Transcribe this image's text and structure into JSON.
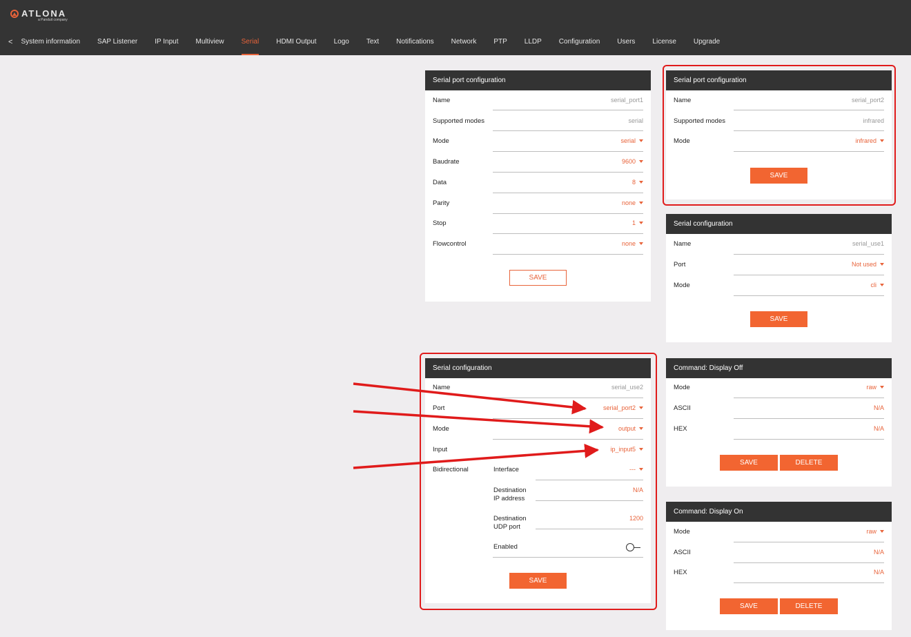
{
  "header": {
    "logo_text": "ATLONA",
    "logo_sub": "a Panduit company",
    "back_label": "<",
    "tabs": [
      "System information",
      "SAP Listener",
      "IP Input",
      "Multiview",
      "Serial",
      "HDMI Output",
      "Logo",
      "Text",
      "Notifications",
      "Network",
      "PTP",
      "LLDP",
      "Configuration",
      "Users",
      "License",
      "Upgrade"
    ],
    "active_tab": "Serial"
  },
  "port1": {
    "title": "Serial port configuration",
    "name_label": "Name",
    "name_value": "serial_port1",
    "modes_label": "Supported modes",
    "modes_value": "serial",
    "mode_label": "Mode",
    "mode_value": "serial",
    "baud_label": "Baudrate",
    "baud_value": "9600",
    "data_label": "Data",
    "data_value": "8",
    "parity_label": "Parity",
    "parity_value": "none",
    "stop_label": "Stop",
    "stop_value": "1",
    "flow_label": "Flowcontrol",
    "flow_value": "none",
    "save_label": "SAVE"
  },
  "port2": {
    "title": "Serial port configuration",
    "name_label": "Name",
    "name_value": "serial_port2",
    "modes_label": "Supported modes",
    "modes_value": "infrared",
    "mode_label": "Mode",
    "mode_value": "infrared",
    "save_label": "SAVE"
  },
  "use1": {
    "title": "Serial configuration",
    "name_label": "Name",
    "name_value": "serial_use1",
    "port_label": "Port",
    "port_value": "Not used",
    "mode_label": "Mode",
    "mode_value": "cli",
    "save_label": "SAVE"
  },
  "use2": {
    "title": "Serial configuration",
    "name_label": "Name",
    "name_value": "serial_use2",
    "port_label": "Port",
    "port_value": "serial_port2",
    "mode_label": "Mode",
    "mode_value": "output",
    "input_label": "Input",
    "input_value": "ip_input5",
    "bidir_label": "Bidirectional",
    "iface_label": "Interface",
    "iface_value": "---",
    "dest_ip_label_1": "Destination",
    "dest_ip_label_2": "IP address",
    "dest_ip_value": "N/A",
    "dest_udp_label_1": "Destination",
    "dest_udp_label_2": "UDP port",
    "dest_udp_value": "1200",
    "enabled_label": "Enabled",
    "save_label": "SAVE"
  },
  "cmd_off": {
    "title": "Command: Display Off",
    "mode_label": "Mode",
    "mode_value": "raw",
    "ascii_label": "ASCII",
    "ascii_value": "N/A",
    "hex_label": "HEX",
    "hex_value": "N/A",
    "save_label": "SAVE",
    "delete_label": "DELETE"
  },
  "cmd_on": {
    "title": "Command: Display On",
    "mode_label": "Mode",
    "mode_value": "raw",
    "ascii_label": "ASCII",
    "ascii_value": "N/A",
    "hex_label": "HEX",
    "hex_value": "N/A",
    "save_label": "SAVE",
    "delete_label": "DELETE"
  },
  "colors": {
    "accent": "#f26531",
    "highlight": "#e01b1b",
    "header_bg": "#343434"
  }
}
